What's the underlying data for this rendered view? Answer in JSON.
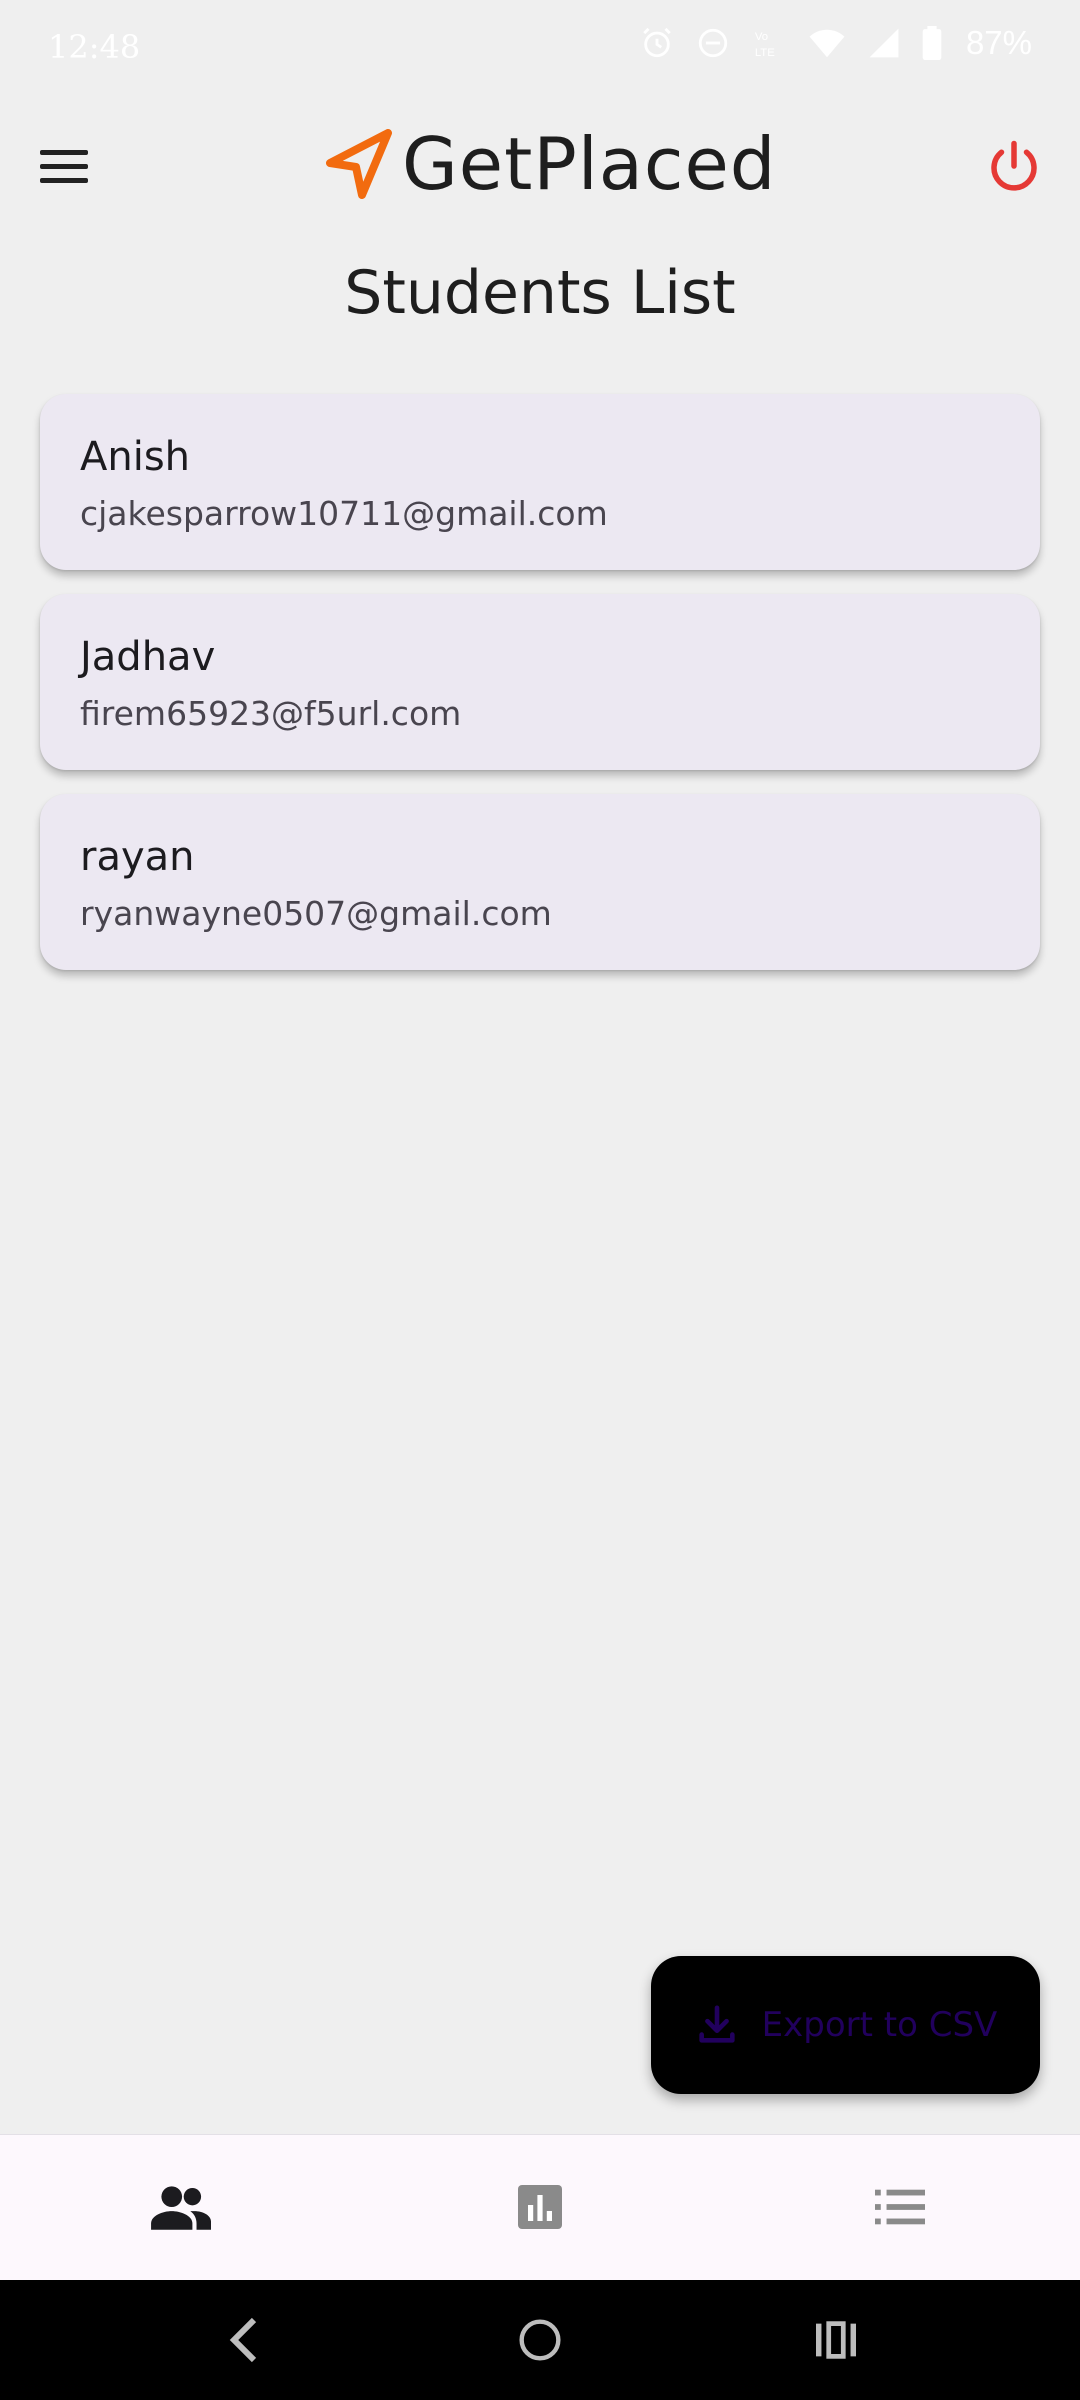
{
  "status_bar": {
    "time": "12:48",
    "battery": "87%",
    "icons": [
      "alarm-icon",
      "dnd-icon",
      "volte-icon",
      "wifi-icon",
      "signal-icon",
      "battery-icon"
    ]
  },
  "app_bar": {
    "brand": "GetPlaced",
    "brand_color": "#f26b0f",
    "power_color": "#e53935"
  },
  "page": {
    "title": "Students List"
  },
  "students": [
    {
      "name": "Anish",
      "email": "cjakesparrow10711@gmail.com"
    },
    {
      "name": "Jadhav",
      "email": "firem65923@f5url.com"
    },
    {
      "name": "rayan",
      "email": "ryanwayne0507@gmail.com"
    }
  ],
  "fab": {
    "label": "Export to CSV",
    "icon": "download-icon"
  },
  "bottom_nav": {
    "items": [
      {
        "icon": "people-icon",
        "active": true
      },
      {
        "icon": "bar-chart-icon",
        "active": false
      },
      {
        "icon": "list-icon",
        "active": false
      }
    ]
  }
}
